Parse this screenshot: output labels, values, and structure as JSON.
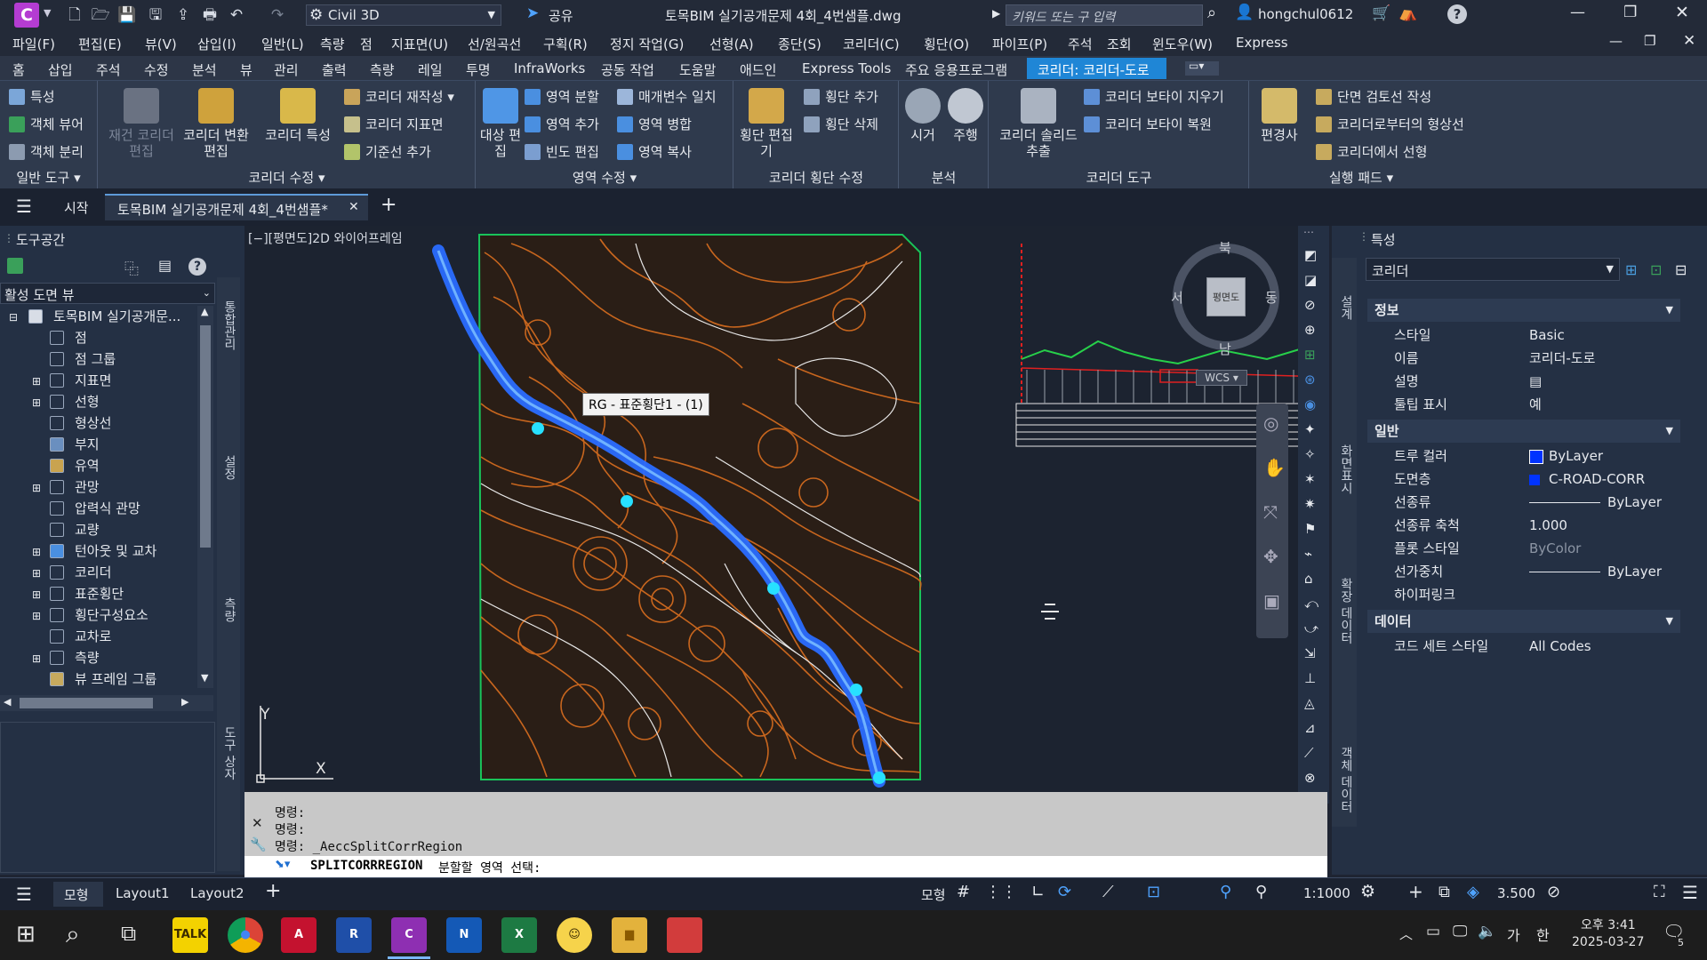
{
  "app": {
    "logo": "C",
    "workspace": "Civil 3D",
    "share": "공유",
    "title": "토목BIM 실기공개문제 4회_4번샘플.dwg",
    "search_placeholder": "키워드 또는 구 입력",
    "user": "hongchul0612",
    "help": "?"
  },
  "menu": [
    "파일(F)",
    "편집(E)",
    "뷰(V)",
    "삽입(I)",
    "일반(L)",
    "측량",
    "점",
    "지표면(U)",
    "선/원곡선",
    "구획(R)",
    "정지 작업(G)",
    "선형(A)",
    "종단(S)",
    "코리더(C)",
    "횡단(O)",
    "파이프(P)",
    "주석",
    "조회",
    "윈도우(W)",
    "Express"
  ],
  "ribbon_tabs": [
    "홈",
    "삽입",
    "주석",
    "수정",
    "분석",
    "뷰",
    "관리",
    "출력",
    "측량",
    "레일",
    "투명",
    "InfraWorks",
    "공동 작업",
    "도움말",
    "애드인",
    "Express Tools",
    "주요 응용프로그램",
    "코리더: 코리더-도로"
  ],
  "ribbon_active": "코리더: 코리더-도로",
  "ribbon": {
    "g1": {
      "title": "일반 도구 ▾",
      "items": [
        "특성",
        "객체 뷰어",
        "객체 분리"
      ]
    },
    "g2": {
      "title": "코리더 수정 ▾",
      "large": [
        "재건 코리더 편집",
        "코리더 변환 편집",
        "코리더 특성"
      ],
      "small": [
        "코리더 재작성",
        "코리더 지표면",
        "기준선 추가"
      ]
    },
    "g3": {
      "title": "영역 수정 ▾",
      "large": [
        "대상 편집"
      ],
      "small": [
        "영역 분할",
        "영역 추가",
        "빈도 편집",
        "매개변수 일치",
        "영역 병합",
        "영역 복사"
      ]
    },
    "g4": {
      "title": "코리더 횡단 수정",
      "large": [
        "횡단 편집기"
      ],
      "small": [
        "횡단 추가",
        "횡단 삭제"
      ]
    },
    "g5": {
      "title": "분석",
      "large": [
        "시거",
        "주행"
      ]
    },
    "g6": {
      "title": "코리더 도구",
      "large": [
        "코리더 솔리드 추출"
      ],
      "small": [
        "코리더 보타이 지우기",
        "코리더 보타이 복원"
      ]
    },
    "g7": {
      "title": "실행 패드 ▾",
      "large": [
        "편경사"
      ],
      "small": [
        "단면 검토선 작성",
        "코리더로부터의 형상선",
        "코리더에서 선형"
      ]
    }
  },
  "doctabs": {
    "start": "시작",
    "active": "토목BIM 실기공개문제 4회_4번샘플*"
  },
  "toolspace": {
    "title": "도구공간",
    "view_select": "활성 도면 뷰",
    "root": "토목BIM 실기공개문...",
    "items": [
      "점",
      "점 그룹",
      "지표면",
      "선형",
      "형상선",
      "부지",
      "유역",
      "관망",
      "압력식 관망",
      "교량",
      "턴아웃 및 교차",
      "코리더",
      "표준횡단",
      "횡단구성요소",
      "교차로",
      "측량",
      "뷰 프레임 그룹"
    ],
    "side_labels": [
      "통합관리",
      "설정",
      "측량",
      "도구 상자"
    ]
  },
  "viewport": {
    "label": "[−][평면도]2D 와이어프레임",
    "tooltip": "RG - 표준횡단1 - (1)",
    "compass": {
      "n": "북",
      "s": "남",
      "e": "동",
      "w": "서",
      "center": "평면도"
    },
    "wcs": "WCS",
    "ucs_y": "Y",
    "ucs_x": "X"
  },
  "command": {
    "history": [
      "명령:",
      "명령:",
      "명령: _AeccSplitCorrRegion"
    ],
    "prompt_cmd": "SPLITCORRREGION",
    "prompt_text": "분할할 영역 선택:"
  },
  "properties": {
    "title": "특성",
    "selection": "코리더",
    "side_labels": [
      "설계",
      "화면표시",
      "확장 데이터",
      "객체 데이터"
    ],
    "sections": [
      {
        "name": "정보",
        "rows": [
          [
            "스타일",
            "Basic"
          ],
          [
            "이름",
            "코리더-도로"
          ],
          [
            "설명",
            ""
          ],
          [
            "툴팁 표시",
            "예"
          ]
        ]
      },
      {
        "name": "일반",
        "rows": [
          [
            "트루 컬러",
            "ByLayer"
          ],
          [
            "도면층",
            "C-ROAD-CORR"
          ],
          [
            "선종류",
            "ByLayer"
          ],
          [
            "선종류 축척",
            "1.000"
          ],
          [
            "플롯 스타일",
            "ByColor"
          ],
          [
            "선가중치",
            "ByLayer"
          ],
          [
            "하이퍼링크",
            ""
          ]
        ]
      },
      {
        "name": "데이터",
        "rows": [
          [
            "코드 세트 스타일",
            "All Codes"
          ]
        ]
      }
    ],
    "colors": {
      "truecolor": "#0033ff",
      "layer": "#0033ff"
    }
  },
  "status": {
    "tabs": [
      "모형",
      "Layout1",
      "Layout2"
    ],
    "model": "모형",
    "scale": "1:1000",
    "value": "3.500"
  },
  "taskbar": {
    "time": "오후 3:41",
    "date": "2025-03-27",
    "ime": "가",
    "lang": "한",
    "notif": "5",
    "apps": [
      "TALK",
      "A",
      "R",
      "C",
      "N",
      "X",
      "☺",
      "▆",
      "●"
    ]
  },
  "colors": {
    "contour": "#c8661e",
    "corridor": "#2a6dff",
    "boundary": "#19c35a"
  }
}
